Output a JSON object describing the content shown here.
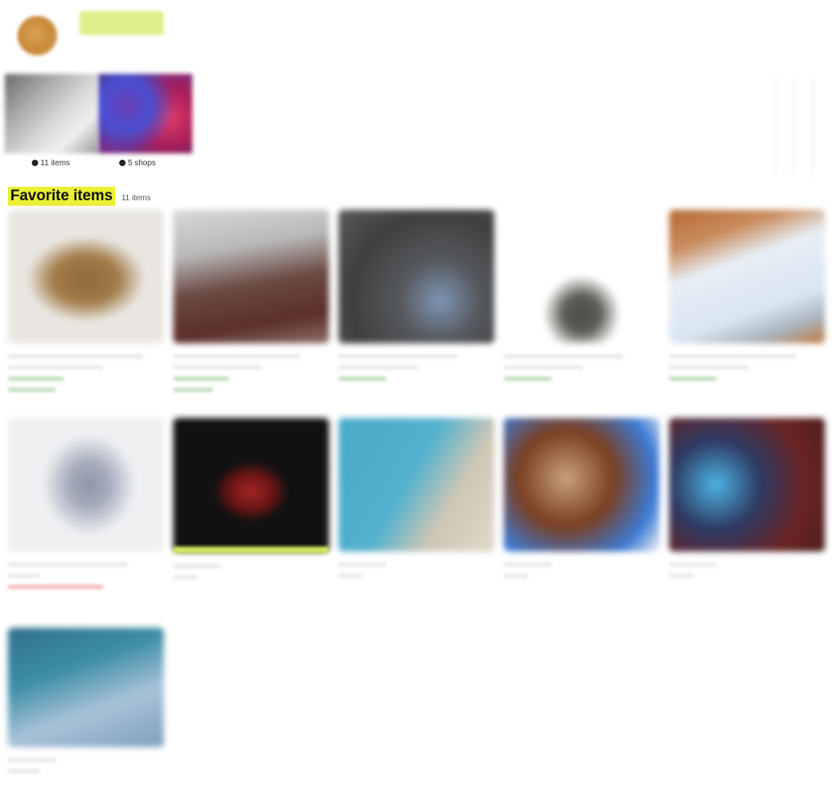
{
  "collections": {
    "items_label": "11 items",
    "shops_label": "5 shops"
  },
  "favorites": {
    "title": "Favorite items",
    "count": "11 items"
  },
  "colors": {
    "heading_highlight": "#eaf034",
    "profile_pill": "#e0ee8a"
  }
}
